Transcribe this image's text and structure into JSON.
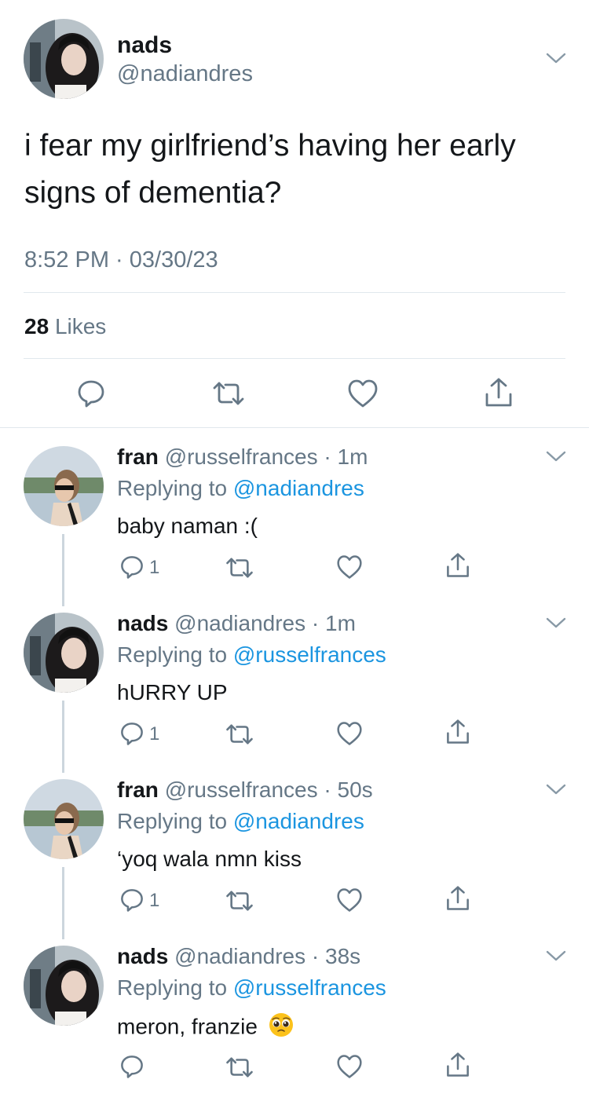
{
  "main_tweet": {
    "name": "nads",
    "handle": "@nadiandres",
    "text_line1": "i fear my girlfriend’s having her early",
    "text_line2": "signs of dementia?",
    "timestamp": "8:52 PM · 03/30/23",
    "likes_count": "28",
    "likes_label": "Likes"
  },
  "replies": [
    {
      "name": "fran",
      "handle": "@russelfrances",
      "time": "· 1m",
      "replying_prefix": "Replying to",
      "replying_to": "@nadiandres",
      "text": "baby naman :(",
      "reply_count": "1"
    },
    {
      "name": "nads",
      "handle": "@nadiandres",
      "time": "· 1m",
      "replying_prefix": "Replying to",
      "replying_to": "@russelfrances",
      "text": "hURRY UP",
      "reply_count": "1"
    },
    {
      "name": "fran",
      "handle": "@russelfrances",
      "time": "· 50s",
      "replying_prefix": "Replying to",
      "replying_to": "@nadiandres",
      "text": "‘yoq wala nmn kiss",
      "reply_count": "1"
    },
    {
      "name": "nads",
      "handle": "@nadiandres",
      "time": "· 38s",
      "replying_prefix": "Replying to",
      "replying_to": "@russelfrances",
      "text": "meron, franzie",
      "reply_count": "",
      "emoji": "pleading-face-emoji"
    }
  ],
  "colors": {
    "link": "#1b95e0",
    "secondary_text": "#657786",
    "divider": "#e1e8ed",
    "thread_line": "#ccd6dd"
  }
}
